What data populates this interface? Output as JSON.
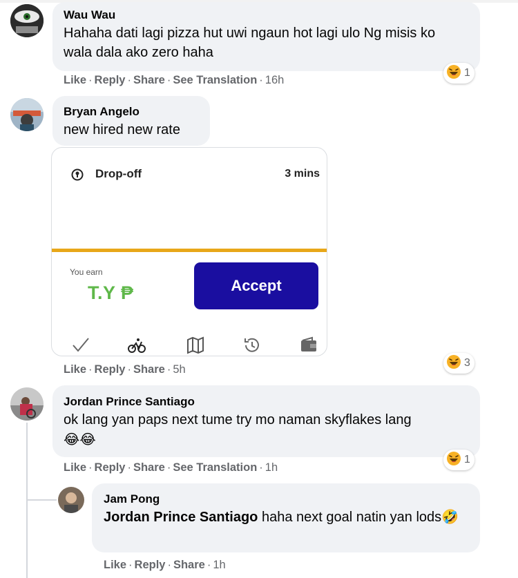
{
  "comments": [
    {
      "author": "Wau Wau",
      "text": "Hahaha dati lagi pizza hut uwi ngaun hot lagi ulo Ng misis ko wala dala ako zero haha",
      "actions": [
        "Like",
        "Reply",
        "Share",
        "See Translation"
      ],
      "time": "16h",
      "reaction": {
        "icon": "haha-emoji-icon",
        "count": "1"
      }
    },
    {
      "author": "Bryan Angelo",
      "text": "new hired new rate",
      "attachment": {
        "label": "Drop-off",
        "duration": "3 mins",
        "earn_label": "You earn",
        "earn_value": "T.Y ₱",
        "accept_label": "Accept",
        "nav_icons": [
          "check-icon",
          "bicycle-icon",
          "map-icon",
          "history-icon",
          "wallet-icon"
        ]
      },
      "actions": [
        "Like",
        "Reply",
        "Share"
      ],
      "time": "5h",
      "reaction": {
        "icon": "haha-emoji-icon",
        "count": "3"
      }
    },
    {
      "author": "Jordan Prince Santiago",
      "text": "ok lang yan paps next tume try mo naman skyflakes lang",
      "emojis": "😂😂",
      "actions": [
        "Like",
        "Reply",
        "Share",
        "See Translation"
      ],
      "time": "1h",
      "reaction": {
        "icon": "haha-emoji-icon",
        "count": "1"
      }
    }
  ],
  "reply": {
    "author": "Jam Pong",
    "mention": "Jordan Prince Santiago",
    "text": "haha next goal natin yan lods🤣",
    "actions": [
      "Like",
      "Reply",
      "Share"
    ],
    "time": "1h"
  },
  "colors": {
    "bubble": "#f0f2f5",
    "meta_text": "#65676b",
    "accept_button": "#1a0ea0",
    "earn_text": "#5fb84a",
    "divider": "#e8a719"
  }
}
